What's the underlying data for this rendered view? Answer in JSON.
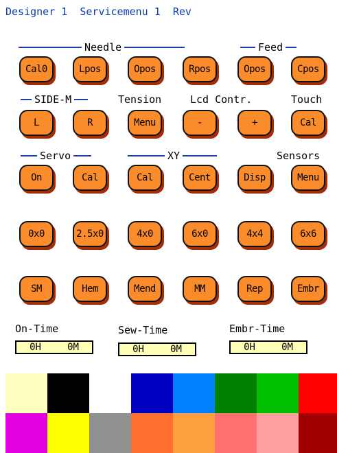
{
  "header": {
    "title": "Designer 1  Servicemenu 1  Rev"
  },
  "sections": {
    "needle": "Needle",
    "feed": "Feed",
    "side_m": "SIDE-M",
    "tension": "Tension",
    "lcd_contr": "Lcd Contr.",
    "touch": "Touch",
    "servo": "Servo",
    "xy": "XY",
    "sensors": "Sensors"
  },
  "buttons": {
    "row1": [
      "Cal0",
      "Lpos",
      "Opos",
      "Rpos",
      "Opos",
      "Cpos"
    ],
    "row2": [
      "L",
      "R",
      "Menu",
      "-",
      "+",
      "Cal"
    ],
    "row3": [
      "On",
      "Cal",
      "Cal",
      "Cent",
      "Disp",
      "Menu"
    ],
    "row4": [
      "0x0",
      "2.5x0",
      "4x0",
      "6x0",
      "4x4",
      "6x6"
    ],
    "row5": [
      "SM",
      "Hem",
      "Mend",
      "MM",
      "Rep",
      "Embr"
    ]
  },
  "timers": [
    {
      "label": "On-Time",
      "hours": "0H",
      "minutes": "0M"
    },
    {
      "label": "Sew-Time",
      "hours": "0H",
      "minutes": "0M"
    },
    {
      "label": "Embr-Time",
      "hours": "0H",
      "minutes": "0M"
    }
  ],
  "palette": {
    "row1": [
      "#ffffc0",
      "#000000",
      "#ffffff",
      "#0000c0",
      "#0080ff",
      "#008000",
      "#00c000",
      "#ff0000"
    ],
    "row2": [
      "#e000e0",
      "#ffff00",
      "#909090",
      "#ff7030",
      "#ffa040",
      "#ff7070",
      "#ffa0a0",
      "#a00000"
    ]
  }
}
